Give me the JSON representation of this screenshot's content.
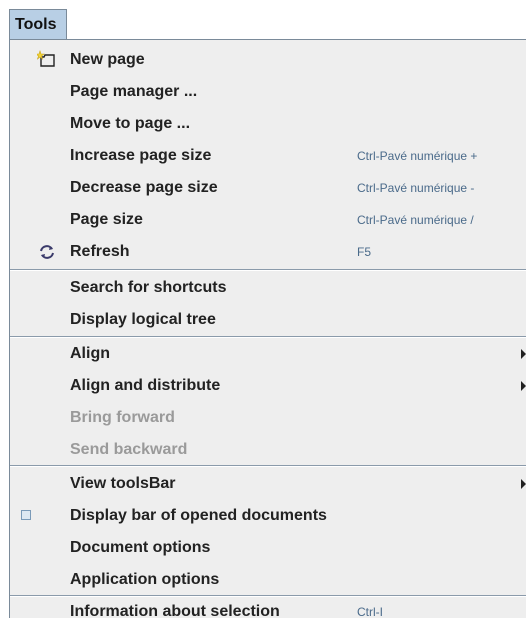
{
  "menu": {
    "title": "Tools"
  },
  "items": [
    {
      "label": "New page",
      "accelerator": "",
      "icon": "new-page-icon"
    },
    {
      "label": "Page manager ...",
      "accelerator": ""
    },
    {
      "label": "Move to page ...",
      "accelerator": ""
    },
    {
      "label": "Increase page size",
      "accelerator": "Ctrl-Pavé numérique +"
    },
    {
      "label": "Decrease page size",
      "accelerator": "Ctrl-Pavé numérique -"
    },
    {
      "label": "Page size",
      "accelerator": "Ctrl-Pavé numérique /"
    },
    {
      "label": "Refresh",
      "accelerator": "F5",
      "icon": "refresh-icon"
    },
    {
      "label": "Search for shortcuts",
      "accelerator": ""
    },
    {
      "label": "Display logical tree",
      "accelerator": ""
    },
    {
      "label": "Align",
      "accelerator": "",
      "submenu": true
    },
    {
      "label": "Align and distribute",
      "accelerator": "",
      "submenu": true
    },
    {
      "label": "Bring forward",
      "accelerator": "",
      "disabled": true
    },
    {
      "label": "Send backward",
      "accelerator": "",
      "disabled": true
    },
    {
      "label": "View toolsBar",
      "accelerator": "",
      "submenu": true
    },
    {
      "label": "Display bar of opened documents",
      "accelerator": "",
      "icon": "checkbox-icon"
    },
    {
      "label": "Document options",
      "accelerator": ""
    },
    {
      "label": "Application options",
      "accelerator": ""
    },
    {
      "label": "Information about selection",
      "accelerator": "Ctrl-I"
    }
  ],
  "colors": {
    "menu_title_bg": "#b8cfe5",
    "popup_bg": "#eeeeee",
    "accelerator_text": "#4a6a8a",
    "disabled_text": "#9a9a9a",
    "separator": "#8a9aaa"
  }
}
